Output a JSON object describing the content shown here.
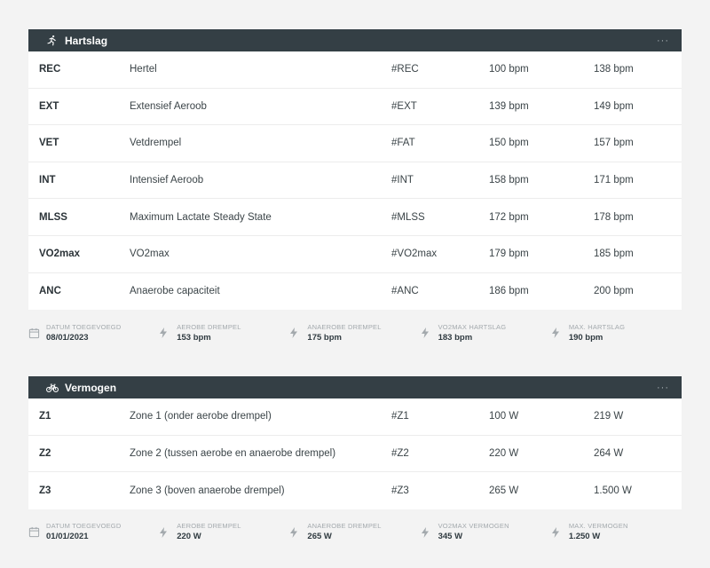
{
  "panels": [
    {
      "title": "Hartslag",
      "icon": "running-person-icon",
      "more_label": "···",
      "rows": [
        {
          "code": "REC",
          "name": "Hertel",
          "tag": "#REC",
          "min": "100 bpm",
          "max": "138 bpm"
        },
        {
          "code": "EXT",
          "name": "Extensief Aeroob",
          "tag": "#EXT",
          "min": "139 bpm",
          "max": "149 bpm"
        },
        {
          "code": "VET",
          "name": "Vetdrempel",
          "tag": "#FAT",
          "min": "150 bpm",
          "max": "157 bpm"
        },
        {
          "code": "INT",
          "name": "Intensief Aeroob",
          "tag": "#INT",
          "min": "158 bpm",
          "max": "171 bpm"
        },
        {
          "code": "MLSS",
          "name": "Maximum Lactate Steady State",
          "tag": "#MLSS",
          "min": "172 bpm",
          "max": "178 bpm"
        },
        {
          "code": "VO2max",
          "name": "VO2max",
          "tag": "#VO2max",
          "min": "179 bpm",
          "max": "185 bpm"
        },
        {
          "code": "ANC",
          "name": "Anaerobe capaciteit",
          "tag": "#ANC",
          "min": "186 bpm",
          "max": "200 bpm"
        }
      ],
      "summary": [
        {
          "label": "Datum toegevoegd",
          "value": "08/01/2023",
          "icon": "calendar-icon"
        },
        {
          "label": "Aerobe drempel",
          "value": "153 bpm",
          "icon": "bolt-icon"
        },
        {
          "label": "Anaerobe drempel",
          "value": "175 bpm",
          "icon": "bolt-icon"
        },
        {
          "label": "VO2max hartslag",
          "value": "183 bpm",
          "icon": "bolt-icon"
        },
        {
          "label": "Max. hartslag",
          "value": "190 bpm",
          "icon": "bolt-icon"
        }
      ]
    },
    {
      "title": "Vermogen",
      "icon": "bicycle-icon",
      "more_label": "···",
      "rows": [
        {
          "code": "Z1",
          "name": "Zone 1 (onder aerobe drempel)",
          "tag": "#Z1",
          "min": "100 W",
          "max": "219 W"
        },
        {
          "code": "Z2",
          "name": "Zone 2 (tussen aerobe en anaerobe drempel)",
          "tag": "#Z2",
          "min": "220 W",
          "max": "264 W"
        },
        {
          "code": "Z3",
          "name": "Zone 3 (boven anaerobe drempel)",
          "tag": "#Z3",
          "min": "265 W",
          "max": "1.500 W"
        }
      ],
      "summary": [
        {
          "label": "Datum toegevoegd",
          "value": "01/01/2021",
          "icon": "calendar-icon"
        },
        {
          "label": "Aerobe drempel",
          "value": "220 W",
          "icon": "bolt-icon"
        },
        {
          "label": "Anaerobe drempel",
          "value": "265 W",
          "icon": "bolt-icon"
        },
        {
          "label": "VO2max vermogen",
          "value": "345 W",
          "icon": "bolt-icon"
        },
        {
          "label": "Max. vermogen",
          "value": "1.250 W",
          "icon": "bolt-icon"
        }
      ]
    }
  ],
  "colors": {
    "header_bg": "#343f45",
    "page_bg": "#f3f3f3",
    "row_bg": "#ffffff"
  }
}
